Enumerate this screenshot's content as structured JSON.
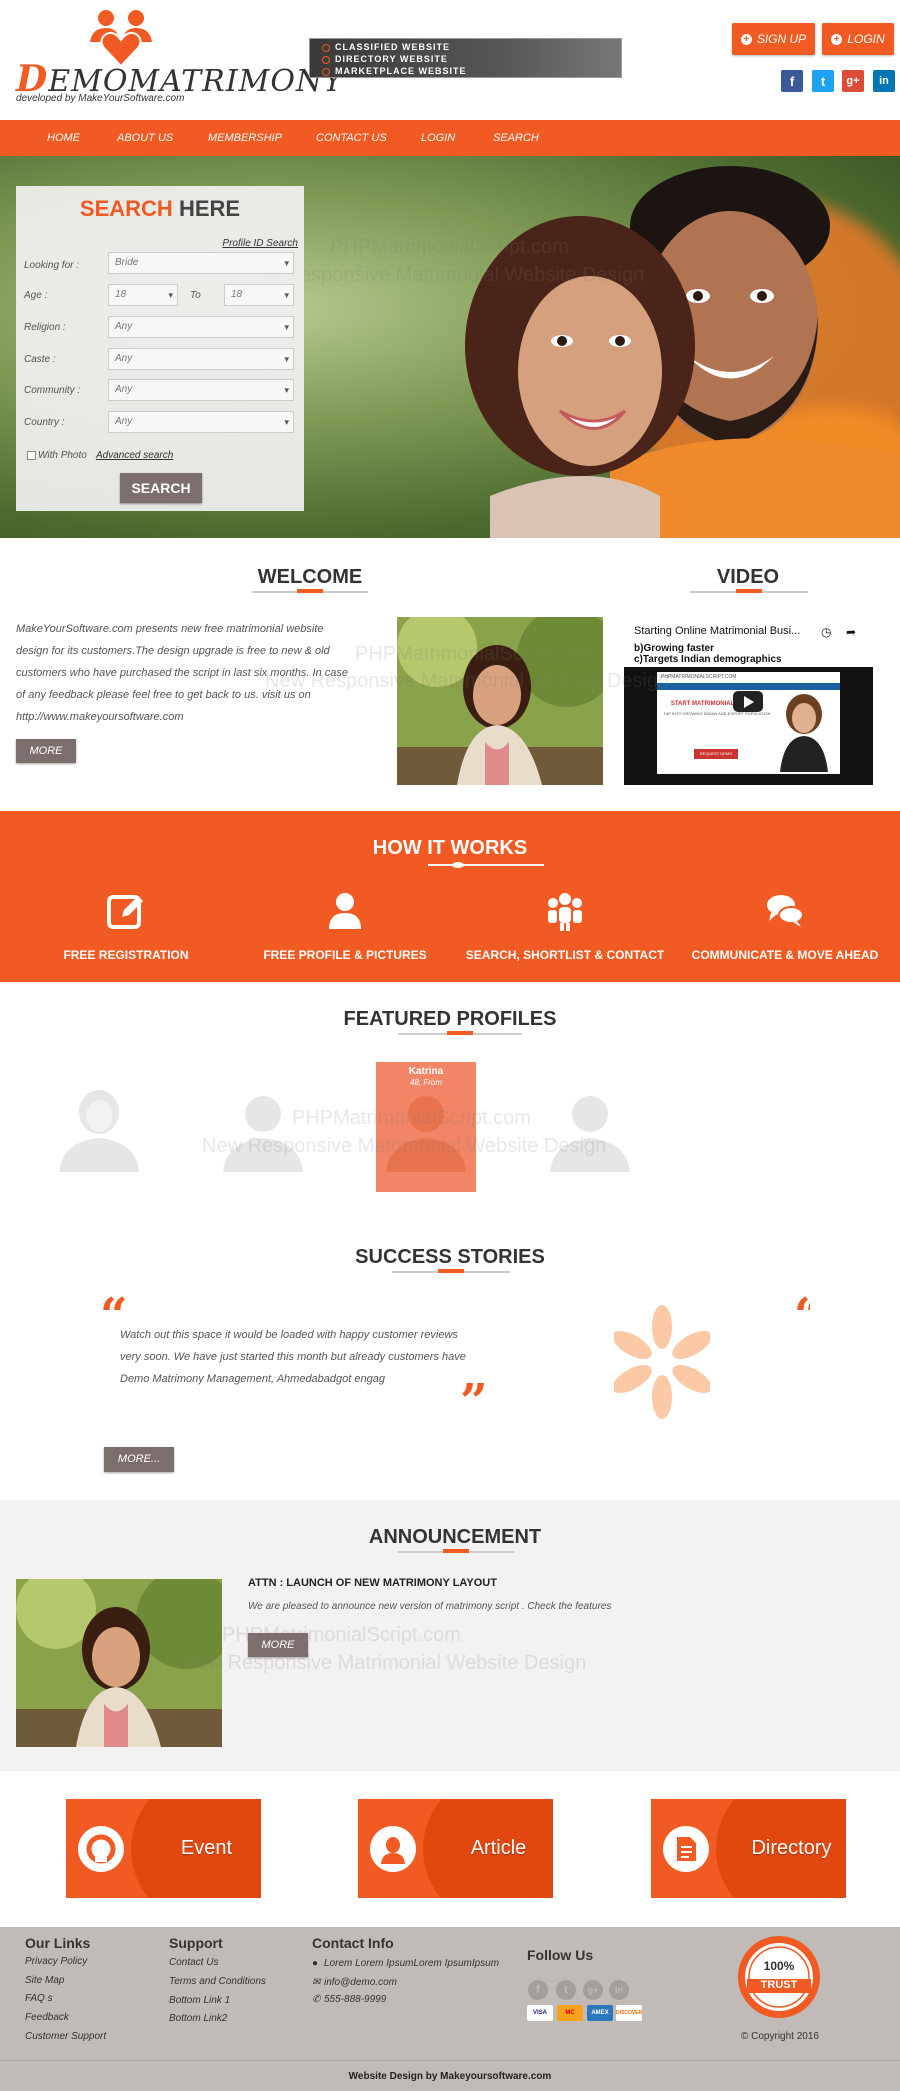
{
  "header": {
    "logo_text_d": "D",
    "logo_text_rest": "EMOMATRIMONY",
    "logo_sub": "developed by MakeYourSoftware.com",
    "banner_lines": [
      "CLASSIFIED WEBSITE",
      "DIRECTORY WEBSITE",
      "MARKETPLACE WEBSITE"
    ],
    "signup": "SIGN UP",
    "login": "LOGIN",
    "social": [
      "f",
      "t",
      "g+",
      "in"
    ],
    "social_colors": [
      "#3b5998",
      "#1da1f2",
      "#dd4b39",
      "#0077b5"
    ]
  },
  "nav": [
    "HOME",
    "ABOUT US",
    "MEMBERSHIP",
    "CONTACT US",
    "LOGIN",
    "SEARCH"
  ],
  "search": {
    "title_hl": "SEARCH",
    "title_rest": " HERE",
    "profile_id_link": "Profile ID Search",
    "looking_for_label": "Looking for :",
    "looking_for_value": "Bride",
    "age_label": "Age :",
    "age_from": "18",
    "age_to_label": "To",
    "age_to": "18",
    "religion_label": "Religion :",
    "caste_label": "Caste :",
    "community_label": "Community :",
    "country_label": "Country :",
    "any": "Any",
    "with_photo": "With Photo",
    "advanced": "Advanced search",
    "button": "SEARCH"
  },
  "watermark": {
    "line1": "PHPMatrimonialScript.com",
    "line2": "New Responsive Matrimonial Website Design"
  },
  "welcome": {
    "title": "WELCOME",
    "text": "MakeYourSoftware.com presents new free matrimonial website design for its customers.The design upgrade is free to new & old customers who have purchased the script in last six months. In case of any feedback please feel free to get back to us. visit us on http://www.makeyoursoftware.com",
    "more": "MORE"
  },
  "video": {
    "title": "VIDEO",
    "video_title": "Starting Online Matrimonial Busi...",
    "line_b": "b)Growing faster",
    "line_c": "c)Targets Indian demographics",
    "site": "PHPMATRIMONIALSCRIPT.COM",
    "inner_heading": "START MATRIMONIAL WEBSITE",
    "inner_sub": "TAP INTO GROWING INDIAN AND EXPORT POPULATION",
    "inner_btn": "REQUEST DEMO"
  },
  "how": {
    "title": "HOW IT WORKS",
    "items": [
      "FREE REGISTRATION",
      "FREE PROFILE & PICTURES",
      "SEARCH, SHORTLIST & CONTACT",
      "COMMUNICATE & MOVE AHEAD"
    ]
  },
  "featured": {
    "title": "FEATURED PROFILES",
    "card_name": "Katrina",
    "card_info": "48, From"
  },
  "stories": {
    "title": "SUCCESS STORIES",
    "open_quote": "“",
    "close_quote": "”",
    "text": "Watch out this space it would be loaded with happy customer reviews very soon. We have just started this month but already customers have Demo Matrimony Management, Ahmedabadgot engag",
    "more": "MORE..."
  },
  "announcement": {
    "title": "ANNOUNCEMENT",
    "heading": "ATTN : LAUNCH OF NEW MATRIMONY LAYOUT",
    "text": "We are pleased to announce new version of matrimony script . Check the features",
    "more": "MORE"
  },
  "promos": [
    "Event",
    "Article",
    "Directory"
  ],
  "footer": {
    "links_head": "Our Links",
    "links": [
      "Privacy Policy",
      "Site Map",
      "FAQ s",
      "Feedback",
      "Customer Support"
    ],
    "support_head": "Support",
    "support": [
      "Contact Us",
      "Terms and Conditions",
      "Bottom Link 1",
      "Bottom Link2"
    ],
    "contact_head": "Contact Info",
    "address": "Lorem Lorem IpsumLorem IpsumIpsum",
    "email": "info@demo.com",
    "phone": "555-888-9999",
    "follow_head": "Follow Us",
    "follow_icons": [
      "f",
      "t",
      "g+",
      "in"
    ],
    "cards": [
      "VISA",
      "MC",
      "AMEX",
      "DISCOVER"
    ],
    "trust_pct": "100%",
    "trust_word": "TRUST",
    "copyright": "© Copyright 2016",
    "bottom": "Website Design by Makeyoursoftware.com"
  }
}
